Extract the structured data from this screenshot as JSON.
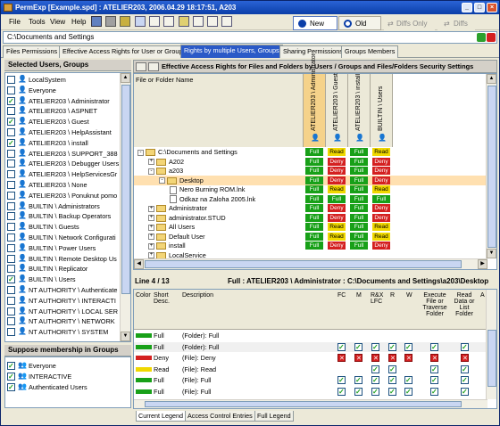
{
  "window": {
    "title": "PermExp [Example.spd] : ATELIER203, 2006.04.29  18:17:51, A203"
  },
  "menu": [
    {
      "label": "File"
    },
    {
      "label": "Tools"
    },
    {
      "label": "View"
    },
    {
      "label": "Help"
    }
  ],
  "toolbar": {
    "new_label": "New",
    "old_label": "Old",
    "diffs_only_label": "Diffs Only",
    "diffs_label": "Diffs"
  },
  "path": {
    "value": "C:\\Documents and Settings"
  },
  "tabs": [
    {
      "label": "Files Permissions"
    },
    {
      "label": "Effective Access Rights for User or Group"
    },
    {
      "label": "Rights by multiple Users, Groups"
    },
    {
      "label": "Sharing Permissions"
    },
    {
      "label": "Groups Members"
    }
  ],
  "left": {
    "selected_title": "Selected Users, Groups",
    "users": [
      {
        "checked": false,
        "name": "LocalSystem"
      },
      {
        "checked": false,
        "name": "Everyone"
      },
      {
        "checked": true,
        "name": "ATELIER203 \\ Administrator"
      },
      {
        "checked": false,
        "name": "ATELIER203 \\ ASPNET"
      },
      {
        "checked": true,
        "name": "ATELIER203 \\ Guest"
      },
      {
        "checked": false,
        "name": "ATELIER203 \\ HelpAssistant"
      },
      {
        "checked": true,
        "name": "ATELIER203 \\ install"
      },
      {
        "checked": false,
        "name": "ATELIER203 \\ SUPPORT_388"
      },
      {
        "checked": false,
        "name": "ATELIER203 \\ Debugger Users"
      },
      {
        "checked": false,
        "name": "ATELIER203 \\ HelpServicesGr"
      },
      {
        "checked": false,
        "name": "ATELIER203 \\ None"
      },
      {
        "checked": false,
        "name": "ATELIER203 \\ Ponuknut pomo"
      },
      {
        "checked": false,
        "name": "BUILTIN \\ Administrators"
      },
      {
        "checked": false,
        "name": "BUILTIN \\ Backup Operators"
      },
      {
        "checked": false,
        "name": "BUILTIN \\ Guests"
      },
      {
        "checked": false,
        "name": "BUILTIN \\ Network Configurati"
      },
      {
        "checked": false,
        "name": "BUILTIN \\ Power Users"
      },
      {
        "checked": false,
        "name": "BUILTIN \\ Remote Desktop Us"
      },
      {
        "checked": false,
        "name": "BUILTIN \\ Replicator"
      },
      {
        "checked": true,
        "name": "BUILTIN \\ Users"
      },
      {
        "checked": false,
        "name": "NT AUTHORITY \\ Authenticate"
      },
      {
        "checked": false,
        "name": "NT AUTHORITY \\ INTERACTI"
      },
      {
        "checked": false,
        "name": "NT AUTHORITY \\ LOCAL SER"
      },
      {
        "checked": false,
        "name": "NT AUTHORITY \\ NETWORK"
      },
      {
        "checked": false,
        "name": "NT AUTHORITY \\ SYSTEM"
      }
    ],
    "membership_title": "Suppose membership in Groups",
    "groups": [
      {
        "checked": true,
        "name": "Everyone"
      },
      {
        "checked": true,
        "name": "INTERACTIVE"
      },
      {
        "checked": true,
        "name": "Authenticated Users"
      }
    ]
  },
  "right": {
    "title": "Effective Access Rights for Files and Folders by Users / Groups and Files/Folders Security Settings",
    "name_header": "File or Folder Name",
    "columns": [
      "ATELIER203 \\ Administrator",
      "ATELIER203 \\ Guest",
      "ATELIER203 \\ install",
      "BUILTIN \\ Users"
    ],
    "rows": [
      {
        "expander": "□",
        "icon": "folder",
        "name": "C:\\Documents and Settings",
        "indent": 0,
        "cells": [
          "Full",
          "Read",
          "Full",
          "Read"
        ]
      },
      {
        "expander": "+",
        "icon": "folder",
        "name": "A202",
        "indent": 1,
        "cells": [
          "Full",
          "Deny",
          "Full",
          "Deny"
        ]
      },
      {
        "expander": "□",
        "icon": "folder",
        "name": "a203",
        "indent": 1,
        "cells": [
          "Full",
          "Deny",
          "Full",
          "Deny"
        ]
      },
      {
        "expander": "□",
        "icon": "folder",
        "name": "Desktop",
        "indent": 2,
        "cells": [
          "Full",
          "Deny",
          "Full",
          "Deny"
        ]
      },
      {
        "expander": "",
        "icon": "file",
        "name": "Nero Burning ROM.lnk",
        "indent": 3,
        "cells": [
          "Full",
          "Read",
          "Full",
          "Read"
        ]
      },
      {
        "expander": "",
        "icon": "file",
        "name": "Odkaz na Zaloha 2005.lnk",
        "indent": 3,
        "cells": [
          "Full",
          "Full",
          "Full",
          "Full"
        ]
      },
      {
        "expander": "+",
        "icon": "folder",
        "name": "Administrator",
        "indent": 1,
        "cells": [
          "Full",
          "Deny",
          "Full",
          "Deny"
        ]
      },
      {
        "expander": "+",
        "icon": "folder",
        "name": "administrator.STUD",
        "indent": 1,
        "cells": [
          "Full",
          "Deny",
          "Full",
          "Deny"
        ]
      },
      {
        "expander": "+",
        "icon": "folder",
        "name": "All Users",
        "indent": 1,
        "cells": [
          "Full",
          "Read",
          "Full",
          "Read"
        ]
      },
      {
        "expander": "+",
        "icon": "folder",
        "name": "Default User",
        "indent": 1,
        "cells": [
          "Full",
          "Read",
          "Full",
          "Read"
        ]
      },
      {
        "expander": "+",
        "icon": "folder",
        "name": "install",
        "indent": 1,
        "cells": [
          "Full",
          "Deny",
          "Full",
          "Deny"
        ]
      },
      {
        "expander": "+",
        "icon": "folder",
        "name": "LocalService",
        "indent": 1,
        "cells": []
      }
    ],
    "line_info": "Line 4 / 13",
    "selection_info": "Full : ATELIER203 \\ Administrator : C:\\Documents and Settings\\a203\\Desktop",
    "bottom_headers": {
      "color": "Color",
      "short": "Short Desc.",
      "desc": "Description",
      "fc": "FC",
      "m": "M",
      "rx": "R&X LFC",
      "r": "R",
      "w": "W",
      "exec": "Execute File or Traverse Folder",
      "read": "Read Data or List Folder",
      "extra": "A"
    },
    "details": [
      {
        "color": "#18a018",
        "short": "Full",
        "desc": "(Folder): Full",
        "marks": [
          "",
          "",
          "",
          "",
          "",
          "",
          ""
        ]
      },
      {
        "color": "#18a018",
        "short": "Full",
        "desc": "(Folder): Full",
        "marks": [
          "c",
          "c",
          "c",
          "c",
          "c",
          "c",
          "c"
        ]
      },
      {
        "color": "#d42020",
        "short": "Deny",
        "desc": "(File): Deny",
        "marks": [
          "x",
          "x",
          "x",
          "x",
          "x",
          "x",
          "x"
        ]
      },
      {
        "color": "#f0d800",
        "short": "Read",
        "desc": "(File): Read",
        "marks": [
          "",
          "",
          "c",
          "c",
          "",
          "c",
          "c"
        ]
      },
      {
        "color": "#18a018",
        "short": "Full",
        "desc": "(File): Full",
        "marks": [
          "c",
          "c",
          "c",
          "c",
          "c",
          "c",
          "c"
        ]
      },
      {
        "color": "#18a018",
        "short": "Full",
        "desc": "(File): Full",
        "marks": [
          "c",
          "c",
          "c",
          "c",
          "c",
          "c",
          "c"
        ]
      }
    ],
    "bottom_tabs": [
      {
        "label": "Current Legend"
      },
      {
        "label": "Access Control Entries"
      },
      {
        "label": "Full Legend"
      }
    ]
  }
}
